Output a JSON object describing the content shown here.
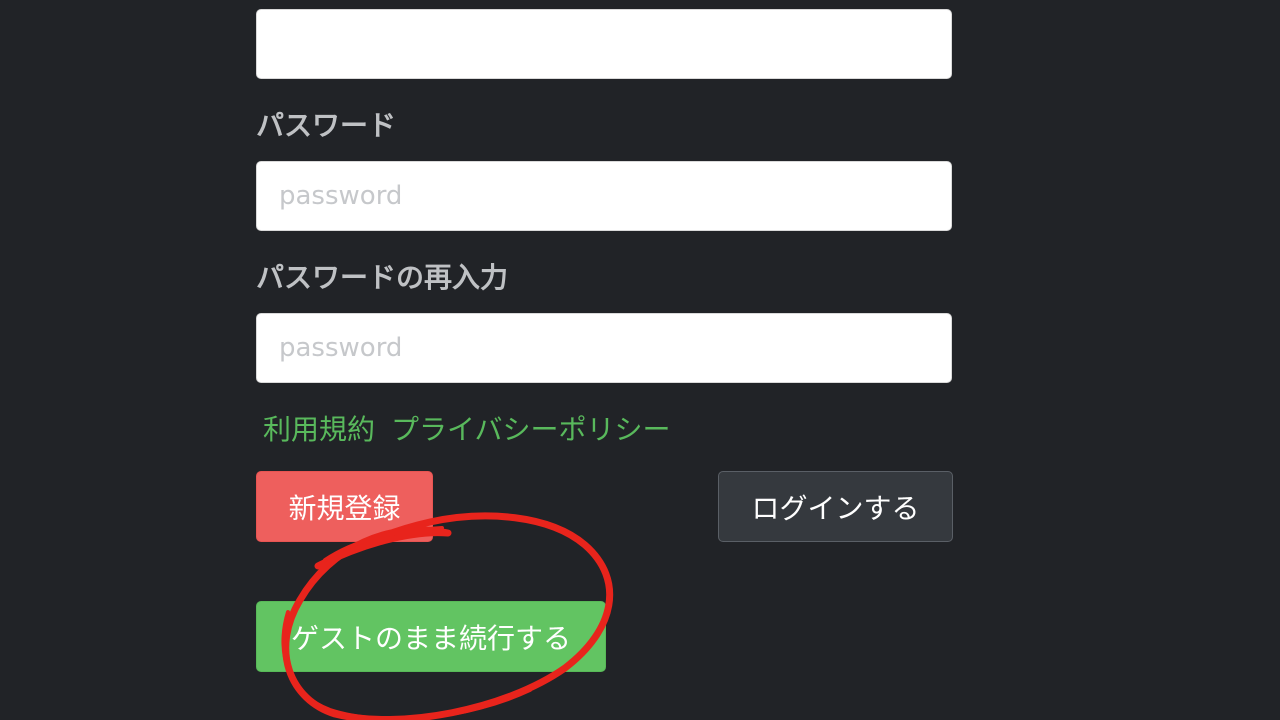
{
  "form": {
    "top_input": {
      "value": "",
      "placeholder": ""
    },
    "password": {
      "label": "パスワード",
      "placeholder": "password",
      "value": ""
    },
    "password_confirm": {
      "label": "パスワードの再入力",
      "placeholder": "password",
      "value": ""
    }
  },
  "links": {
    "terms": "利用規約",
    "privacy": "プライバシーポリシー"
  },
  "buttons": {
    "register": "新規登録",
    "login": "ログインする",
    "guest": "ゲストのまま続行する"
  },
  "colors": {
    "background": "#212327",
    "link_green": "#59b95c",
    "register_red": "#ee5f5d",
    "login_dark": "#35393e",
    "guest_green": "#62c462",
    "annotation_red": "#e8241c"
  }
}
